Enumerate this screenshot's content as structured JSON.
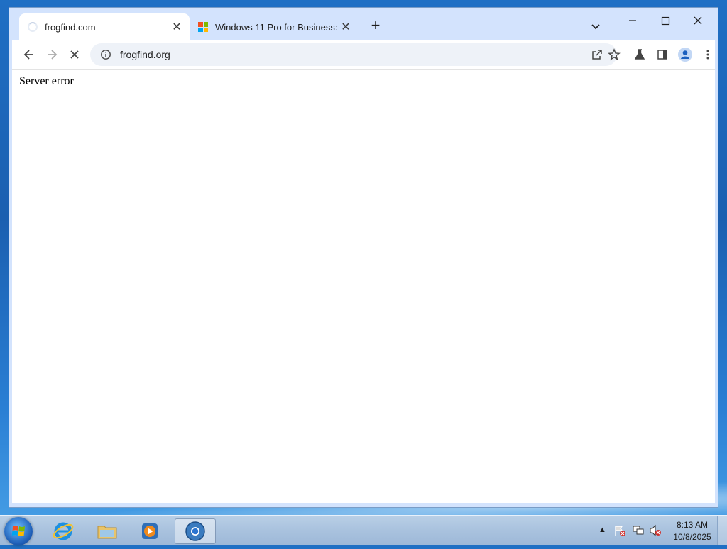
{
  "browser": {
    "tabs": [
      {
        "title": "frogfind.com",
        "active": true,
        "icon": "loading-spinner-icon"
      },
      {
        "title": "Windows 11 Pro for Business: Fe",
        "active": false,
        "icon": "microsoft-logo-icon"
      }
    ],
    "tab_close_glyph": "✕",
    "new_tab_glyph": "+",
    "address": "frogfind.org"
  },
  "page": {
    "text": "Server error"
  },
  "taskbar": {
    "clock_time": "8:13 AM",
    "clock_date": "10/8/2025",
    "tray_overflow_glyph": "▲"
  },
  "colors": {
    "tab_strip": "#d3e3fd",
    "omnibox": "#eef2f8",
    "ms_red": "#f25022",
    "ms_green": "#7fba00",
    "ms_blue": "#00a4ef",
    "ms_yellow": "#ffb900"
  }
}
